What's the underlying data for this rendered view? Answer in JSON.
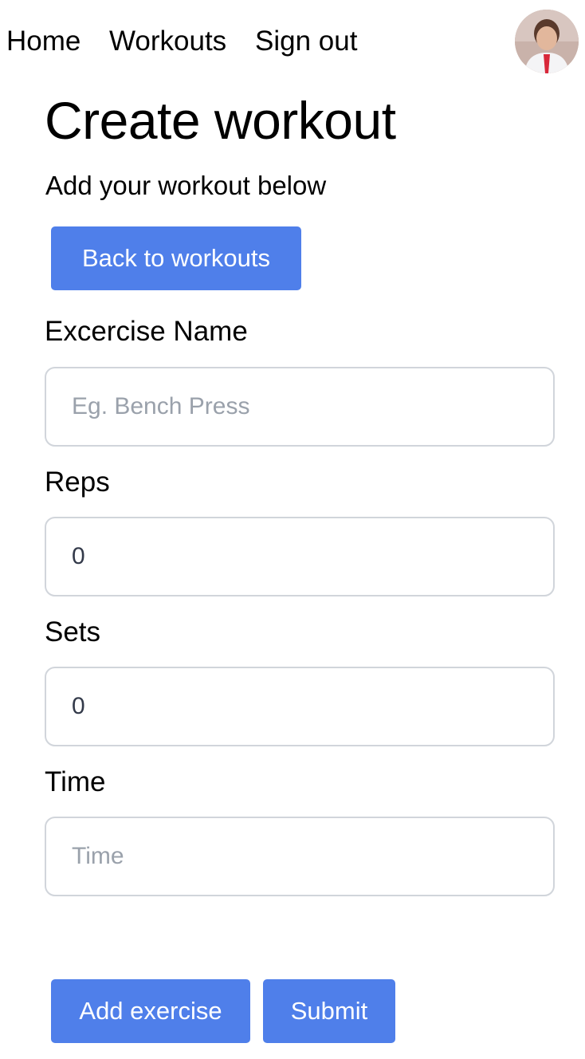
{
  "nav": {
    "items": [
      {
        "label": "Home"
      },
      {
        "label": "Workouts"
      },
      {
        "label": "Sign out"
      }
    ]
  },
  "avatar": {
    "icon": "user-avatar"
  },
  "header": {
    "title": "Create workout",
    "subtitle": "Add your workout below"
  },
  "buttons": {
    "back": "Back to workouts",
    "add_exercise": "Add exercise",
    "submit": "Submit"
  },
  "form": {
    "exercise_name": {
      "label": "Excercise Name",
      "value": "",
      "placeholder": "Eg. Bench Press"
    },
    "reps": {
      "label": "Reps",
      "value": "0",
      "placeholder": ""
    },
    "sets": {
      "label": "Sets",
      "value": "0",
      "placeholder": ""
    },
    "time": {
      "label": "Time",
      "value": "",
      "placeholder": "Time"
    }
  },
  "colors": {
    "accent": "#4f7fea",
    "input_border": "#d1d5db",
    "placeholder": "#9aa1ab"
  }
}
